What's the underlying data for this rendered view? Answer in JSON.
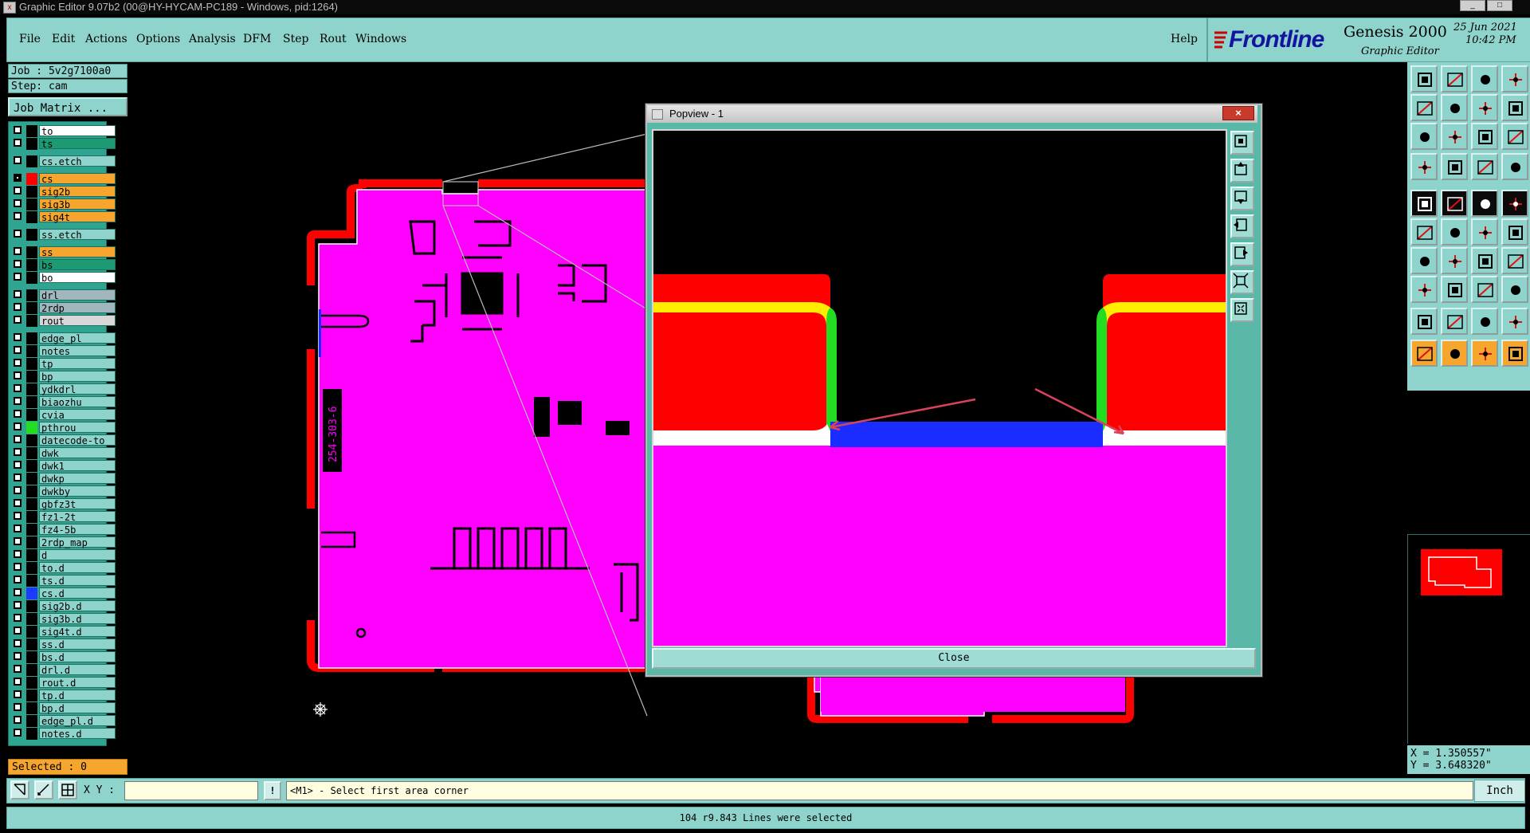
{
  "window": {
    "title": "Graphic Editor 9.07b2 (00@HY-HYCAM-PC189 - Windows, pid:1264)",
    "min_label": "_",
    "max_label": "□"
  },
  "menu": {
    "file": "File",
    "edit": "Edit",
    "actions": "Actions",
    "options": "Options",
    "analysis": "Analysis",
    "dfm": "DFM",
    "step": "Step",
    "rout": "Rout",
    "windows": "Windows",
    "help": "Help"
  },
  "brand": {
    "logo": "Frontline",
    "product": "Genesis 2000",
    "subtitle": "Graphic Editor",
    "date": "25 Jun 2021",
    "time": "10:42 PM"
  },
  "job": {
    "job_line": "Job : 5v2g7100a0",
    "step_line": "Step: cam",
    "matrix_button": "Job Matrix ..."
  },
  "layers": [
    {
      "name": "to",
      "color": "#ffffff",
      "swatch": "#000000",
      "checked": false
    },
    {
      "name": "ts",
      "color": "#1d9a72",
      "swatch": "#000000",
      "checked": false
    },
    {
      "name": "cs.etch",
      "color": "#8fd4cc",
      "swatch": "#000000",
      "checked": false
    },
    {
      "name": "cs",
      "color": "#f6a62f",
      "swatch": "#ff0000",
      "checked": true
    },
    {
      "name": "sig2b",
      "color": "#f6a62f",
      "swatch": "#000000",
      "checked": false
    },
    {
      "name": "sig3b",
      "color": "#f6a62f",
      "swatch": "#000000",
      "checked": false
    },
    {
      "name": "sig4t",
      "color": "#f6a62f",
      "swatch": "#000000",
      "checked": false
    },
    {
      "name": "ss.etch",
      "color": "#8fd4cc",
      "swatch": "#000000",
      "checked": false
    },
    {
      "name": "ss",
      "color": "#f6a62f",
      "swatch": "#000000",
      "checked": false
    },
    {
      "name": "bs",
      "color": "#1d9a72",
      "swatch": "#000000",
      "checked": false
    },
    {
      "name": "bo",
      "color": "#ffffff",
      "swatch": "#000000",
      "checked": false
    },
    {
      "name": "drl",
      "color": "#9fb7bd",
      "swatch": "#000000",
      "checked": false
    },
    {
      "name": "2rdp",
      "color": "#9fb7bd",
      "swatch": "#000000",
      "checked": false
    },
    {
      "name": "rout",
      "color": "#d7d7d7",
      "swatch": "#000000",
      "checked": false
    },
    {
      "name": "edge_pl",
      "color": "#8fd4cc",
      "swatch": "#000000",
      "checked": false
    },
    {
      "name": "notes",
      "color": "#8fd4cc",
      "swatch": "#000000",
      "checked": false
    },
    {
      "name": "tp",
      "color": "#8fd4cc",
      "swatch": "#000000",
      "checked": false
    },
    {
      "name": "bp",
      "color": "#8fd4cc",
      "swatch": "#000000",
      "checked": false
    },
    {
      "name": "ydkdrl",
      "color": "#8fd4cc",
      "swatch": "#000000",
      "checked": false
    },
    {
      "name": "biaozhu",
      "color": "#8fd4cc",
      "swatch": "#000000",
      "checked": false
    },
    {
      "name": "cvia",
      "color": "#8fd4cc",
      "swatch": "#000000",
      "checked": false
    },
    {
      "name": "pthrou",
      "color": "#8fd4cc",
      "swatch": "#22dd22",
      "checked": false
    },
    {
      "name": "datecode-to",
      "color": "#8fd4cc",
      "swatch": "#000000",
      "checked": false
    },
    {
      "name": "dwk",
      "color": "#8fd4cc",
      "swatch": "#000000",
      "checked": false
    },
    {
      "name": "dwk1",
      "color": "#8fd4cc",
      "swatch": "#000000",
      "checked": false
    },
    {
      "name": "dwkp",
      "color": "#8fd4cc",
      "swatch": "#000000",
      "checked": false
    },
    {
      "name": "dwkby",
      "color": "#8fd4cc",
      "swatch": "#000000",
      "checked": false
    },
    {
      "name": "gbfz3t",
      "color": "#8fd4cc",
      "swatch": "#000000",
      "checked": false
    },
    {
      "name": "fz1-2t",
      "color": "#8fd4cc",
      "swatch": "#000000",
      "checked": false
    },
    {
      "name": "fz4-5b",
      "color": "#8fd4cc",
      "swatch": "#000000",
      "checked": false
    },
    {
      "name": "2rdp_map",
      "color": "#8fd4cc",
      "swatch": "#000000",
      "checked": false
    },
    {
      "name": "d",
      "color": "#8fd4cc",
      "swatch": "#000000",
      "checked": false
    },
    {
      "name": "to.d",
      "color": "#8fd4cc",
      "swatch": "#000000",
      "checked": false
    },
    {
      "name": "ts.d",
      "color": "#8fd4cc",
      "swatch": "#000000",
      "checked": false
    },
    {
      "name": "cs.d",
      "color": "#8fd4cc",
      "swatch": "#1d3bff",
      "checked": false
    },
    {
      "name": "sig2b.d",
      "color": "#8fd4cc",
      "swatch": "#000000",
      "checked": false
    },
    {
      "name": "sig3b.d",
      "color": "#8fd4cc",
      "swatch": "#000000",
      "checked": false
    },
    {
      "name": "sig4t.d",
      "color": "#8fd4cc",
      "swatch": "#000000",
      "checked": false
    },
    {
      "name": "ss.d",
      "color": "#8fd4cc",
      "swatch": "#000000",
      "checked": false
    },
    {
      "name": "bs.d",
      "color": "#8fd4cc",
      "swatch": "#000000",
      "checked": false
    },
    {
      "name": "drl.d",
      "color": "#8fd4cc",
      "swatch": "#000000",
      "checked": false
    },
    {
      "name": "rout.d",
      "color": "#8fd4cc",
      "swatch": "#000000",
      "checked": false
    },
    {
      "name": "tp.d",
      "color": "#8fd4cc",
      "swatch": "#000000",
      "checked": false
    },
    {
      "name": "bp.d",
      "color": "#8fd4cc",
      "swatch": "#000000",
      "checked": false
    },
    {
      "name": "edge_pl.d",
      "color": "#8fd4cc",
      "swatch": "#000000",
      "checked": false
    },
    {
      "name": "notes.d",
      "color": "#8fd4cc",
      "swatch": "#000000",
      "checked": false
    }
  ],
  "selection": {
    "label": "Selected : 0"
  },
  "board": {
    "silk_text": "254-303-6"
  },
  "popview": {
    "title": "Popview - 1",
    "close_label": "Close",
    "x_label": "×"
  },
  "command": {
    "xy_label": "X Y :",
    "xy_value": "",
    "prompt": "<M1> - Select first area corner",
    "info_label": "!"
  },
  "status": {
    "message": "104 r9.843 Lines were selected"
  },
  "coords": {
    "x": "X = 1.350557\"",
    "y": "Y = 3.648320\""
  },
  "units": {
    "value": "Inch"
  },
  "colors": {
    "panel": "#8fd4cc",
    "board_fill": "#ff00ff",
    "copper_edge": "#ff0000",
    "highlight": "#f6a62f",
    "selected_blue": "#1a2cff"
  }
}
